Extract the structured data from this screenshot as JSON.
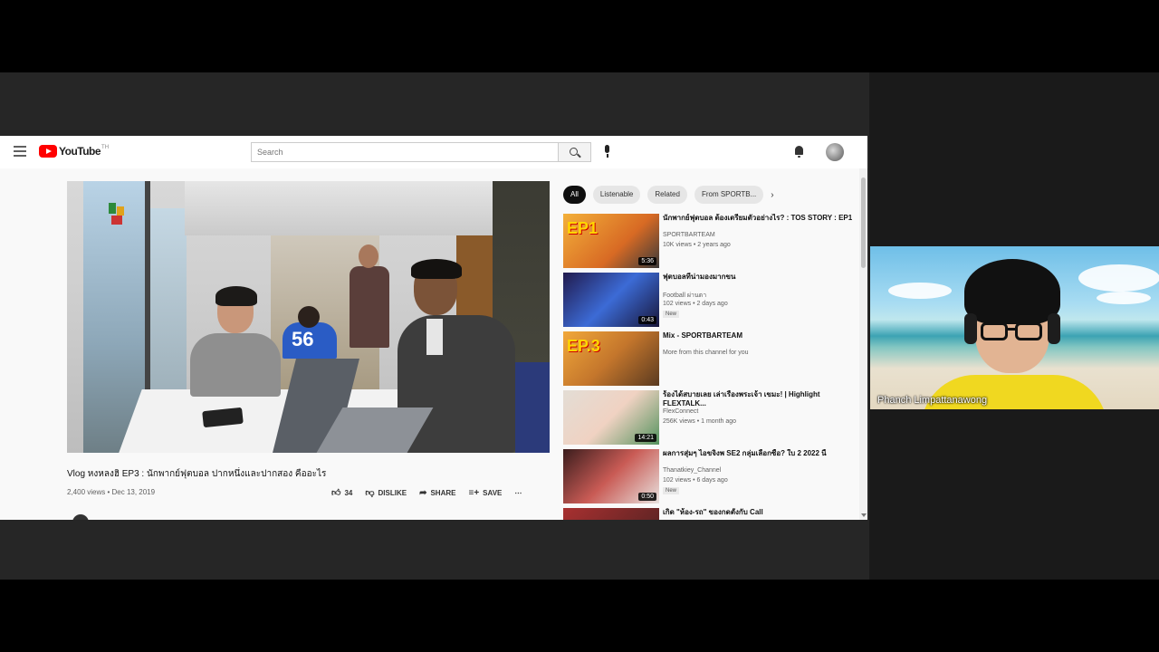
{
  "youtube": {
    "logo_text": "YouTube",
    "logo_region": "TH",
    "search_placeholder": "Search",
    "video": {
      "title": "Vlog หงหลงฮิ EP3 : นักพากย์ฟุตบอล ปากหนึ่งและปากสอง คืออะไร",
      "meta": "2,400 views • Dec 13, 2019",
      "likes": "34",
      "dislike_label": "DISLIKE",
      "share_label": "SHARE",
      "save_label": "SAVE",
      "more_label": "⋯",
      "jersey_number": "56"
    },
    "chips": [
      "All",
      "Listenable",
      "Related",
      "From SPORTB..."
    ],
    "recommendations": [
      {
        "title": "นักพากย์ฟุตบอล ต้องเตรียมตัวอย่างไร? : TOS STORY : EP1",
        "channel": "SPORTBARTEAM",
        "meta": "10K views • 2 years ago",
        "duration": "5:36",
        "badge": "",
        "thumb_text": "EP1"
      },
      {
        "title": "ฟุตบอลที่น่ามองมากขน",
        "channel": "Football ผ่านตา",
        "meta": "102 views • 2 days ago",
        "duration": "0:43",
        "badge": "New",
        "thumb_text": ""
      },
      {
        "title": "Mix - SPORTBARTEAM",
        "channel": "More from this channel for you",
        "meta": "",
        "duration": "",
        "badge": "",
        "thumb_text": "EP.3"
      },
      {
        "title": "ร้องได้สบายเลย เล่าเรื่องพระเจ้า เขมะ! | Highlight FLEXTALK...",
        "channel": "FlexConnect",
        "meta": "256K views • 1 month ago",
        "duration": "14:21",
        "badge": "",
        "thumb_text": ""
      },
      {
        "title": "ผลการสุ่มๆ ไอขจิงพ SE2 กลุ่มเลือกซื้อ? ใบ 2 2022 นี้",
        "channel": "Thanatkiey_Channel",
        "meta": "102 views • 6 days ago",
        "duration": "0:50",
        "badge": "New",
        "thumb_text": ""
      },
      {
        "title": "เกิด \"ห้อง-รถ\" ของกดตั้งกับ Call",
        "channel": "",
        "meta": "",
        "duration": "",
        "badge": "",
        "thumb_text": ""
      }
    ]
  },
  "participant": {
    "name": "Phanch Limpattanawong"
  },
  "icons": {
    "menu": "hamburger-menu-icon",
    "search": "search-icon",
    "mic": "microphone-icon",
    "bell": "bell-icon",
    "like": "thumbs-up-icon",
    "dislike": "thumbs-down-icon",
    "share": "share-arrow-icon",
    "save": "add-to-playlist-icon"
  },
  "colors": {
    "youtube_red": "#ff0000",
    "chip_active": "#0f0f0f",
    "shirt_yellow": "#f0d820"
  }
}
